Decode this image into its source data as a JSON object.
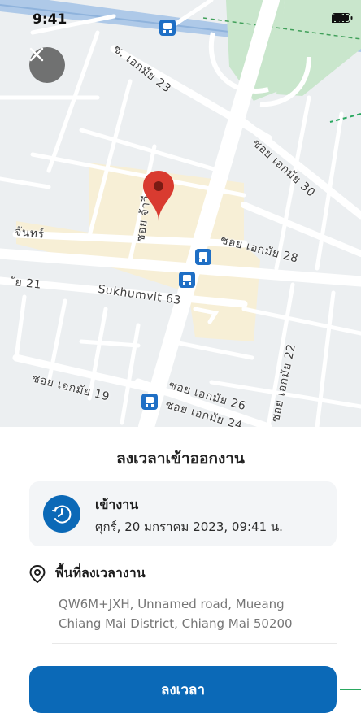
{
  "status_bar": {
    "time": "9:41"
  },
  "map": {
    "labels": {
      "soi_ekkamai_23": "ซ. เอกมัย 23",
      "soi_ekkamai_30": "ซอย เอกมัย 30",
      "jan": "จันทร์",
      "soi_vertical": "ซอย จ้าวี",
      "soi_ekkamai_28": "ซอย เอกมัย 28",
      "soi_21": "ัย 21",
      "sukhumvit_63": "Sukhumvit 63",
      "soi_ekkamai_19": "ซอย เอกมัย 19",
      "soi_ekkamai_26": "ซอย เอกมัย 26",
      "soi_ekkamai_24": "ซอย เอกมัย 24",
      "soi_ekkamai_22": "ซอย เอกมัย 22"
    },
    "icons": {
      "pin": "map-pin-icon",
      "bus": "bus-stop-icon",
      "close": "close-icon"
    }
  },
  "sheet": {
    "title": "ลงเวลาเข้าออกงาน",
    "checkin_card": {
      "icon": "clock-icon",
      "label": "เข้างาน",
      "datetime": "ศุกร์, 20 มกราคม 2023, 09:41 น."
    },
    "location": {
      "icon": "location-pin-icon",
      "heading": "พื้นที่ลงเวลางาน",
      "address": "QW6M+JXH, Unnamed road, Mueang Chiang Mai District, Chiang Mai 50200"
    },
    "submit_label": "ลงเวลา"
  },
  "colors": {
    "primary": "#0b69b7",
    "map_bg": "#eceff1",
    "pin": "#d93b30",
    "card_bg": "#f3f5f7"
  }
}
